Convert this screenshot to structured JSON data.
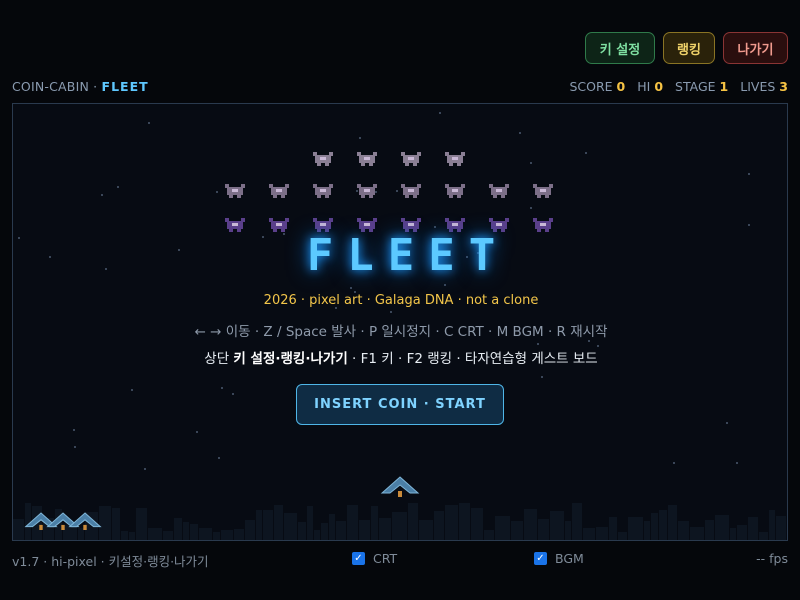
{
  "top_buttons": {
    "keys": "키 설정",
    "ranking": "랭킹",
    "exit": "나가기"
  },
  "hud": {
    "brand_prefix": "COIN-CABIN ·",
    "brand_name": "FLEET",
    "score_label": "SCORE",
    "score": "0",
    "hi_label": "HI",
    "hi": "0",
    "stage_label": "STAGE",
    "stage": "1",
    "lives_label": "LIVES",
    "lives": "3"
  },
  "overlay": {
    "title": "FLEET",
    "tagline": "2026 · pixel art · Galaga DNA · not a clone",
    "controls": "← → 이동 · Z / Space 발사 · P 일시정지 · C CRT · M BGM · R 재시작",
    "hint_pre": "상단 ",
    "hint_bold": "키 설정·랭킹·나가기",
    "hint_post": " · F1 키 · F2 랭킹 · 타자연습형 게스트 보드",
    "start_button": "INSERT COIN · START"
  },
  "footer": {
    "version": "v1.7 · hi-pixel · 키설정·랭킹·나가기",
    "crt_label": "CRT",
    "crt_checked": true,
    "bgm_label": "BGM",
    "bgm_checked": true,
    "fps": "-- fps"
  },
  "colors": {
    "accent": "#5cc9ff",
    "gold": "#f3c64a",
    "enemy_top": "#8a7f94",
    "enemy_bottom": "#5a3f8a",
    "ship": "#4b7fa6"
  }
}
